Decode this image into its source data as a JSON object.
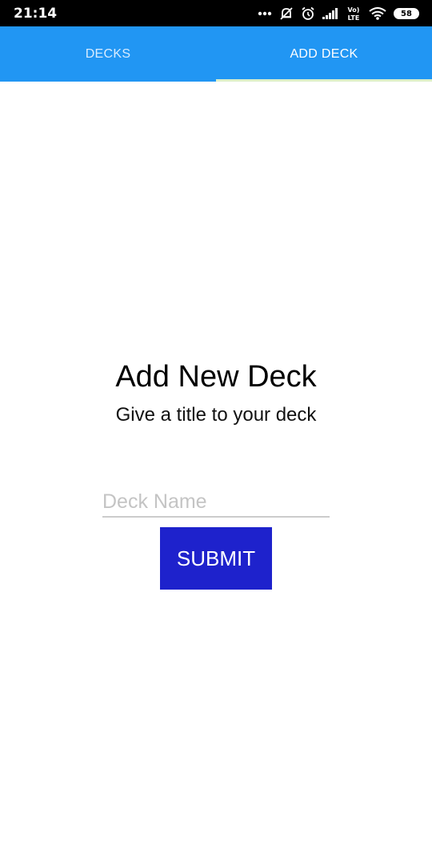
{
  "status_bar": {
    "time": "21:14",
    "battery_level": "58",
    "icons": [
      "more-dots-icon",
      "notifications-off-icon",
      "alarm-icon",
      "signal-icon",
      "volte-lte-icon",
      "wifi-icon",
      "battery-icon"
    ]
  },
  "tabs": [
    {
      "label": "DECKS",
      "active": false
    },
    {
      "label": "ADD DECK",
      "active": true
    }
  ],
  "form": {
    "title": "Add New Deck",
    "subtitle": "Give a title to your deck",
    "deck_name_placeholder": "Deck Name",
    "deck_name_value": "",
    "submit_label": "SUBMIT"
  },
  "colors": {
    "tab_bar": "#2196f3",
    "tab_indicator": "#dcefc9",
    "submit_button": "#1e22cc",
    "status_bar": "#000000"
  }
}
